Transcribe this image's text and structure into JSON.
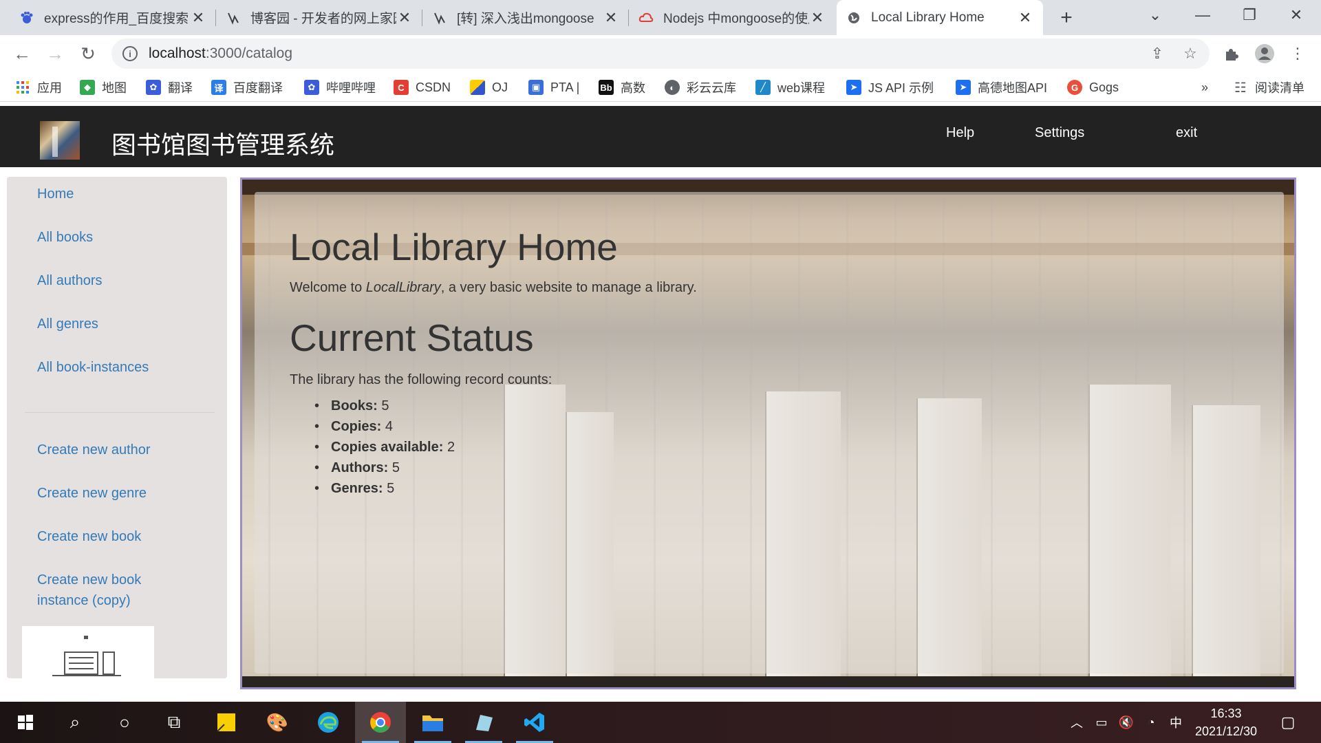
{
  "browser": {
    "tabs": [
      {
        "title": "express的作用_百度搜索",
        "icon": "baidu-icon"
      },
      {
        "title": "博客园 - 开发者的网上家园",
        "icon": "cnblogs-icon"
      },
      {
        "title": "[转] 深入浅出mongoose",
        "icon": "cnblogs-icon"
      },
      {
        "title": "Nodejs 中mongoose的使用",
        "icon": "csdn-cloud-icon"
      },
      {
        "title": "Local Library Home",
        "icon": "globe-icon"
      }
    ],
    "url_host": "localhost",
    "url_path": ":3000/catalog",
    "bookmarks": [
      {
        "label": "应用",
        "icon": "apps-grid-icon"
      },
      {
        "label": "地图",
        "icon": "maps-icon"
      },
      {
        "label": "翻译",
        "icon": "baidu-paw-icon"
      },
      {
        "label": "百度翻译",
        "icon": "translate-icon"
      },
      {
        "label": "哔哩哔哩",
        "icon": "baidu-paw-icon"
      },
      {
        "label": "CSDN",
        "icon": "csdn-icon"
      },
      {
        "label": "OJ",
        "icon": "oj-icon"
      },
      {
        "label": "PTA |",
        "icon": "pta-icon"
      },
      {
        "label": "高数",
        "icon": "bb-icon"
      },
      {
        "label": "彩云云库",
        "icon": "globe-icon"
      },
      {
        "label": "web课程",
        "icon": "web-icon"
      },
      {
        "label": "JS API 示例",
        "icon": "amap-icon"
      },
      {
        "label": "高德地图API",
        "icon": "amap-icon"
      },
      {
        "label": "Gogs",
        "icon": "gogs-icon"
      }
    ],
    "reading_list": "阅读清单",
    "overflow": "»"
  },
  "header": {
    "title": "图书馆图书管理系统",
    "links": [
      "Help",
      "Settings",
      "exit"
    ]
  },
  "sidebar": {
    "primary": [
      "Home",
      "All books",
      "All authors",
      "All genres",
      "All book-instances"
    ],
    "create": [
      "Create new author",
      "Create new genre",
      "Create new book"
    ],
    "create_instance_line1": "Create new book",
    "create_instance_line2": "instance (copy)"
  },
  "main": {
    "title": "Local Library Home",
    "welcome_prefix": "Welcome to ",
    "welcome_brand": "LocalLibrary",
    "welcome_suffix": ", a very basic website to manage a library.",
    "status_heading": "Current Status",
    "counts_intro": "The library has the following record counts:",
    "counts": [
      {
        "label": "Books:",
        "value": "5"
      },
      {
        "label": "Copies:",
        "value": "4"
      },
      {
        "label": "Copies available:",
        "value": "2"
      },
      {
        "label": "Authors:",
        "value": "5"
      },
      {
        "label": "Genres:",
        "value": "5"
      }
    ]
  },
  "taskbar": {
    "time": "16:33",
    "date": "2021/12/30",
    "ime": "中"
  },
  "colors": {
    "header_bg": "#222222",
    "sidebar_bg": "#e6e1e1",
    "link": "#337ab7",
    "content_border": "#9c8ec4"
  }
}
